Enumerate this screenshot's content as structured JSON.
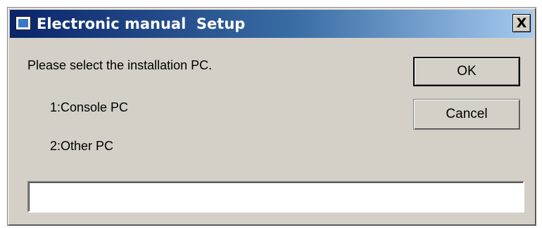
{
  "window": {
    "title": "Electronic manual  Setup",
    "close_label": "X",
    "titlebar_color_start": "#0a246a",
    "titlebar_color_end": "#a6caf0",
    "background_color": "#d4d0c8"
  },
  "dialog": {
    "prompt": "Please select the installation PC.",
    "options": [
      {
        "label": "1:Console PC"
      },
      {
        "label": "2:Other PC"
      }
    ],
    "input": {
      "value": "",
      "placeholder": ""
    }
  },
  "buttons": {
    "ok_label": "OK",
    "cancel_label": "Cancel"
  },
  "icons": {
    "app": "app-window-icon",
    "close": "close-icon"
  }
}
